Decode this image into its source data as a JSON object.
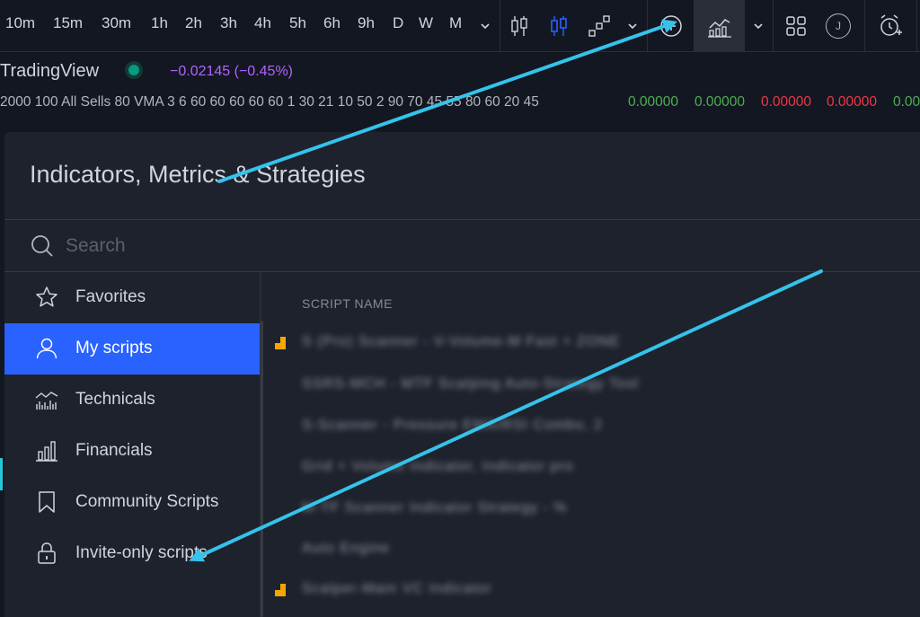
{
  "toolbar": {
    "timeframes": [
      "10m",
      "15m",
      "30m",
      "1h",
      "2h",
      "3h",
      "4h",
      "5h",
      "6h",
      "9h",
      "D",
      "W",
      "M"
    ],
    "profile_initial": "J"
  },
  "symbol": {
    "name": "TradingView",
    "change": "−0.02145 (−0.45%)",
    "params": "2000 100 All Sells 80 VMA 3 6 60 60 60 60 60 1 30 21 10 50 2 90 70 45 55 80 60 20 45",
    "values": [
      {
        "text": "0.00000",
        "color": "#4caf50"
      },
      {
        "text": "0.00000",
        "color": "#4caf50"
      },
      {
        "text": "0.00000",
        "color": "#f23645"
      },
      {
        "text": "0.00000",
        "color": "#f23645"
      },
      {
        "text": "0.00",
        "color": "#4caf50"
      }
    ]
  },
  "dialog": {
    "title": "Indicators, Metrics & Strategies",
    "search_placeholder": "Search",
    "column_header": "SCRIPT NAME",
    "categories": [
      {
        "label": "Favorites",
        "icon": "star-icon"
      },
      {
        "label": "My scripts",
        "icon": "user-icon",
        "active": true
      },
      {
        "label": "Technicals",
        "icon": "technicals-chart-icon"
      },
      {
        "label": "Financials",
        "icon": "bar-chart-icon"
      },
      {
        "label": "Community Scripts",
        "icon": "bookmark-icon"
      },
      {
        "label": "Invite-only scripts",
        "icon": "lock-icon"
      }
    ],
    "scripts": [
      {
        "name": "S (Pro) Scanner - V-Volume-M Fast + ZONE",
        "flag": true
      },
      {
        "name": "SSRS-MCH - MTF Scalping Auto-Strategy Tool",
        "flag": false
      },
      {
        "name": "S-Scanner - Pressure EMA/RSI Combo, 2",
        "flag": false
      },
      {
        "name": "Grid + Volume Indicator, Indicator pro",
        "flag": false
      },
      {
        "name": "M-TF Scanner Indicator Strategy - %",
        "flag": false
      },
      {
        "name": "Auto Engine",
        "flag": false
      },
      {
        "name": "Scalper-Main VC Indicator",
        "flag": true
      }
    ]
  },
  "colors": {
    "background": "#131722",
    "dialog": "#1e222d",
    "accent": "#2962ff",
    "arrow": "#34c3eb",
    "flag": "#f7a600"
  }
}
